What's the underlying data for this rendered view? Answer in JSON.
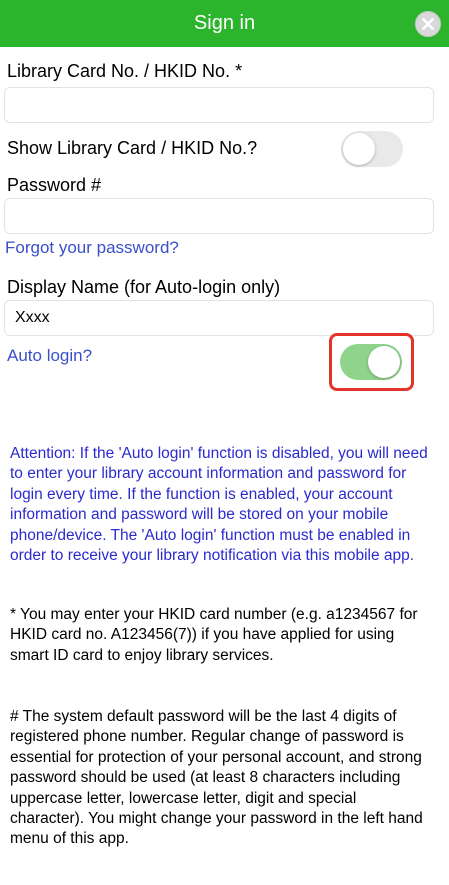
{
  "header": {
    "title": "Sign in",
    "close_icon": "close-x-icon",
    "background": "#2cb52c"
  },
  "form": {
    "card_label": "Library Card No. / HKID No. *",
    "card_value": "",
    "show_card_label": "Show Library Card / HKID No.?",
    "show_card_toggle": false,
    "password_label": "Password #",
    "password_value": "",
    "forgot_password": "Forgot your password?",
    "display_name_label": "Display Name (for Auto-login only)",
    "display_name_value": "Xxxx",
    "auto_login_label": "Auto login?",
    "auto_login_toggle": true
  },
  "texts": {
    "attention": "Attention: If the 'Auto login' function is disabled, you will need to enter your library account information and password for login every time. If the function is enabled, your account information and password will be stored on your mobile phone/device. The 'Auto login' function must be enabled in order to receive your library notification via this mobile app.",
    "note_card": "*  You may enter your HKID card number (e.g. a1234567 for HKID card no. A123456(7)) if you have applied for using smart ID card to enjoy library services.",
    "note_password": "#  The system default password will be the last 4 digits of registered phone number. Regular change of password is essential for protection of your personal account, and strong password should be used (at least 8 characters including uppercase letter, lowercase letter, digit and special character). You might change your password in the left hand menu of this app."
  },
  "colors": {
    "link": "#3a4fc9",
    "toggle_on": "#8fd48a",
    "toggle_off": "#e9e9ea",
    "highlight": "#e2342a",
    "notice_text": "#2a2acf"
  }
}
